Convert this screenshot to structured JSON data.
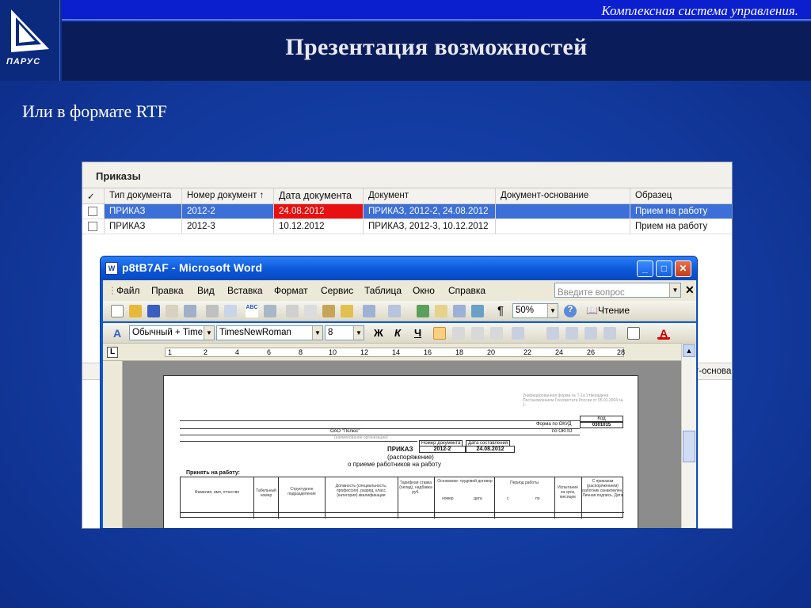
{
  "header": {
    "top_tagline": "Комплексная система управления.",
    "title": "Презентация возможностей",
    "subtitle": "Или в формате RTF",
    "logo_text": "ПАРУС"
  },
  "app": {
    "panel_title": "Приказы",
    "columns": [
      "✓",
      "Тип документа",
      "Номер документ ↑",
      "Дата документа",
      "Документ",
      "Документ-основание",
      "Образец"
    ],
    "rows": [
      {
        "type": "ПРИКАЗ",
        "number": "2012-2",
        "date": "24.08.2012",
        "document": "ПРИКАЗ, 2012-2, 24.08.2012",
        "basis": "",
        "sample": "Прием на работу"
      },
      {
        "type": "ПРИКАЗ",
        "number": "2012-3",
        "date": "10.12.2012",
        "document": "ПРИКАЗ, 2012-3, 10.12.2012",
        "basis": "",
        "sample": "Прием на работу"
      }
    ],
    "hidden_column_fragment": "т-основа"
  },
  "word": {
    "title": "p8tB7AF - Microsoft Word",
    "menu": [
      "Файл",
      "Правка",
      "Вид",
      "Вставка",
      "Формат",
      "Сервис",
      "Таблица",
      "Окно",
      "Справка"
    ],
    "question_placeholder": "Введите вопрос",
    "zoom": "50%",
    "reading_label": "Чтение",
    "style": "Обычный + Time",
    "font": "TimesNewRoman",
    "font_size": "8",
    "bold": "Ж",
    "italic": "К",
    "underline": "Ч",
    "ruler_numbers": [
      "1",
      "2",
      "4",
      "6",
      "8",
      "10",
      "12",
      "14",
      "16",
      "18",
      "20",
      "22",
      "24",
      "26",
      "28"
    ]
  },
  "document": {
    "form_note": "Унифицированная форма № Т-1а Утверждена Постановлением Госкомстата России от 05.01.2004 № 1",
    "code_label": "Код",
    "okud_label": "Форма по ОКУД",
    "okud_value": "0301015",
    "okpo_label": "по ОКПО",
    "org": "ОАО \"Полюс\"",
    "org_note": "(наименование организации)",
    "doc_num_label": "Номер документа",
    "doc_date_label": "Дата составления",
    "order_label": "ПРИКАЗ",
    "order_num": "2012-2",
    "order_date": "24.08.2012",
    "order_sub": "(распоряжение)",
    "order_subject": "о приеме работников на работу",
    "accept_label": "Принять на работу:",
    "table_headers": [
      "Фамилия, имя, отчество",
      "Табельный номер",
      "Структурное подразделение",
      "Должность (специальность, профессия), разряд, класс (категория) квалификации",
      "Тарифная ставка (оклад), надбавка руб.",
      "Основание: трудовой договор",
      "Период работы",
      "Испытание на срок, месяцев",
      "С приказом (распоряжением) работник ознакомлен. Личная подпись. Дата"
    ],
    "sub_headers": [
      "номер",
      "дата",
      "с",
      "по"
    ]
  }
}
